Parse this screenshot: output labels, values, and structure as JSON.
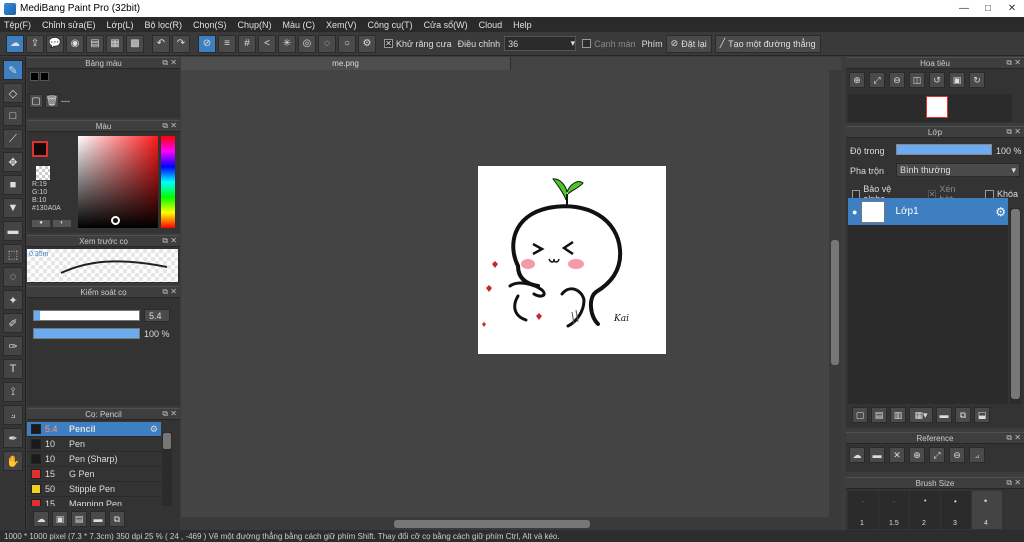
{
  "window": {
    "title": "MediBang Paint Pro (32bit)",
    "minimize": "—",
    "maximize": "□",
    "close": "✕"
  },
  "menu": [
    "Tệp(F)",
    "Chỉnh sửa(E)",
    "Lớp(L)",
    "Bộ lọc(R)",
    "Chọn(S)",
    "Chụp(N)",
    "Màu (C)",
    "Xem(V)",
    "Công cụ(T)",
    "Cửa sổ(W)",
    "Cloud",
    "Help"
  ],
  "toolbar": {
    "antialias_label": "Khử răng cưa",
    "adjust_label": "Điều chỉnh",
    "adjust_value": "36",
    "edge_label": "Cạnh màn",
    "key_label": "Phím",
    "reset_label": "Đặt lại",
    "straight_label": "Tạo một đường thẳng"
  },
  "panels": {
    "palette": "Bảng màu",
    "palette_footer": "---",
    "color": "Màu",
    "color_values": {
      "r": "R:19",
      "g": "G:10",
      "b": "B:10",
      "hex": "#130A0A"
    },
    "preview": "Xem trước cọ",
    "preview_size": "0.35m",
    "brush_control": "Kiểm soát cọ",
    "brush_size_value": "5.4",
    "brush_opacity_value": "100 %",
    "brush_list": "Cọ: Pencil",
    "navigator": "Hoa tiêu",
    "layer": "Lớp",
    "opacity_label": "Độ trong",
    "opacity_value": "100 %",
    "blend_label": "Pha trộn",
    "blend_value": "Bình thường",
    "protect_alpha": "Bảo vệ alpha",
    "clip": "Xén bớt",
    "lock": "Khóa",
    "layer_name": "Lớp1",
    "reference": "Reference",
    "brush_size": "Brush Size",
    "brush_sizes": [
      "1",
      "1.5",
      "2",
      "3",
      "4"
    ]
  },
  "brushes": [
    {
      "size": "5.4",
      "name": "Pencil",
      "color": "#1a1a1a",
      "selected": true
    },
    {
      "size": "10",
      "name": "Pen",
      "color": "#1a1a1a",
      "selected": false
    },
    {
      "size": "10",
      "name": "Pen (Sharp)",
      "color": "#1a1a1a",
      "selected": false
    },
    {
      "size": "15",
      "name": "G Pen",
      "color": "#e03030",
      "selected": false
    },
    {
      "size": "50",
      "name": "Stipple Pen",
      "color": "#f0d020",
      "selected": false
    },
    {
      "size": "15",
      "name": "Mapping Pen",
      "color": "#e03030",
      "selected": false
    }
  ],
  "document": {
    "tab": "me.png",
    "signature": "Kai"
  },
  "status": "1000 * 1000 pixel  (7.3 * 7.3cm)  350 dpi  25 %  ( 24 , -469 )  Vẽ một đường thẳng bằng cách giữ phím Shift. Thay đổi cỡ cọ bằng cách giữ phím Ctrl, Alt và kéo."
}
